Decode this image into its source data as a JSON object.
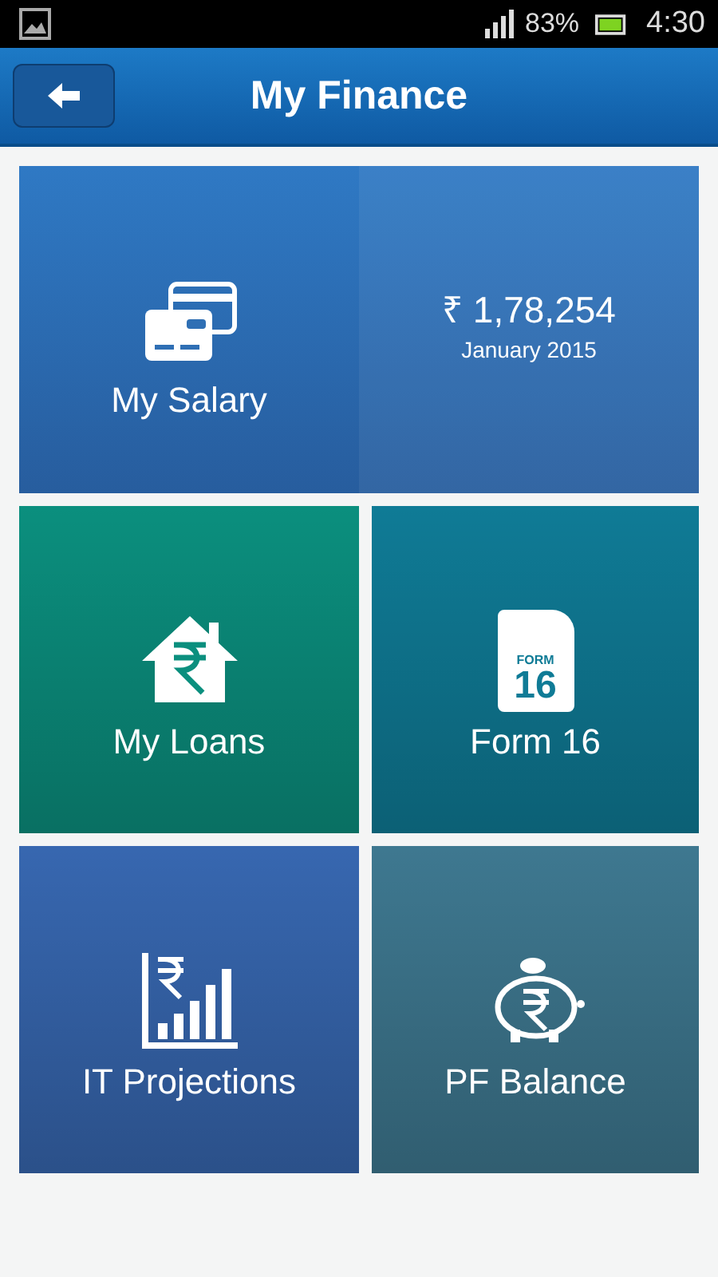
{
  "status_bar": {
    "battery": "83%",
    "time": "4:30"
  },
  "header": {
    "title": "My Finance"
  },
  "salary": {
    "label": "My Salary",
    "amount": "₹ 1,78,254",
    "period": "January 2015",
    "color": "#2f79c4"
  },
  "tiles": [
    {
      "kind": "house",
      "label": "My Loans",
      "color": "#0b8f7e"
    },
    {
      "kind": "form",
      "label": "Form 16",
      "color": "#0f7b96"
    },
    {
      "kind": "chart",
      "label": "IT Projections",
      "color": "#3767b0"
    },
    {
      "kind": "piggy",
      "label": "PF Balance",
      "color": "#3e7890"
    }
  ],
  "form_icon_text": [
    "FORM",
    "16"
  ]
}
